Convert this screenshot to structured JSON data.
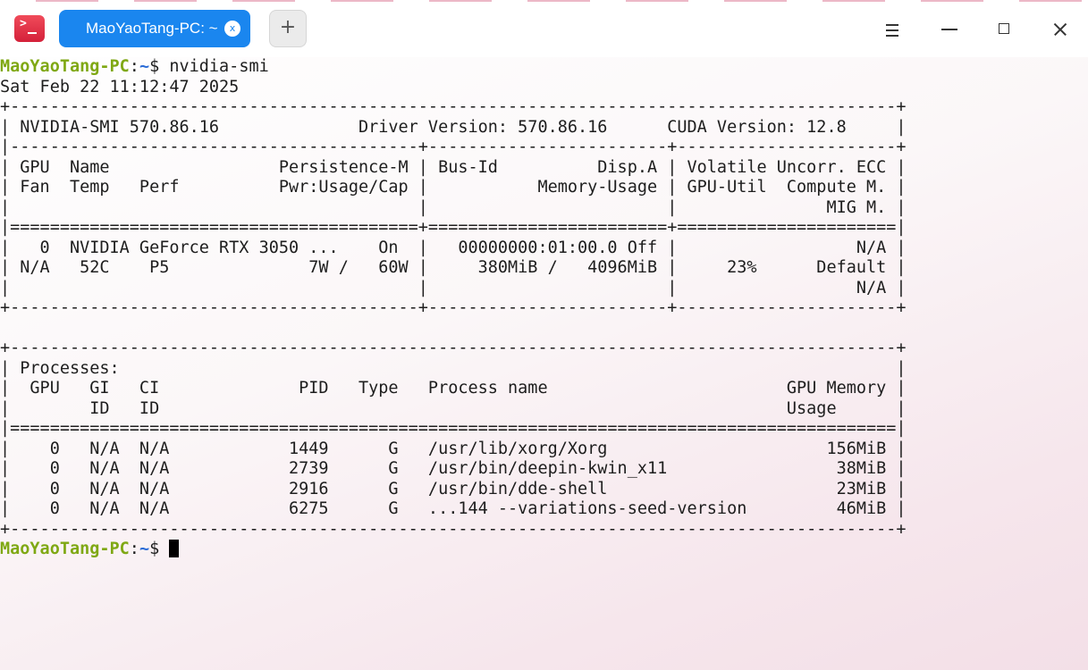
{
  "window": {
    "tab_title": "MaoYaoTang-PC: ~",
    "tab_close_glyph": "x",
    "new_tab_glyph": "+",
    "icons": {
      "app": "terminal-app-icon",
      "menu": "hamburger-menu-icon",
      "minimize": "minimize-icon",
      "maximize": "maximize-icon",
      "close": "close-icon"
    },
    "accent_color": "#1a86ef"
  },
  "terminal": {
    "prompt": {
      "host": "MaoYaoTang-PC",
      "sep": ":",
      "path": "~",
      "symbol": "$ "
    },
    "command": "nvidia-smi",
    "output_lines": [
      "Sat Feb 22 11:12:47 2025",
      "+-----------------------------------------------------------------------------------------+",
      "| NVIDIA-SMI 570.86.16              Driver Version: 570.86.16      CUDA Version: 12.8     |",
      "|-----------------------------------------+------------------------+----------------------+",
      "| GPU  Name                 Persistence-M | Bus-Id          Disp.A | Volatile Uncorr. ECC |",
      "| Fan  Temp   Perf          Pwr:Usage/Cap |           Memory-Usage | GPU-Util  Compute M. |",
      "|                                         |                        |               MIG M. |",
      "|=========================================+========================+======================|",
      "|   0  NVIDIA GeForce RTX 3050 ...    On  |   00000000:01:00.0 Off |                  N/A |",
      "| N/A   52C    P5              7W /   60W |     380MiB /   4096MiB |     23%      Default |",
      "|                                         |                        |                  N/A |",
      "+-----------------------------------------+------------------------+----------------------+",
      "",
      "+-----------------------------------------------------------------------------------------+",
      "| Processes:                                                                              |",
      "|  GPU   GI   CI              PID   Type   Process name                        GPU Memory |",
      "|        ID   ID                                                               Usage      |",
      "|=========================================================================================|",
      "|    0   N/A  N/A            1449      G   /usr/lib/xorg/Xorg                      156MiB |",
      "|    0   N/A  N/A            2739      G   /usr/bin/deepin-kwin_x11                 38MiB |",
      "|    0   N/A  N/A            2916      G   /usr/bin/dde-shell                       23MiB |",
      "|    0   N/A  N/A            6275      G   ...144 --variations-seed-version         46MiB |",
      "+-----------------------------------------------------------------------------------------+"
    ]
  }
}
